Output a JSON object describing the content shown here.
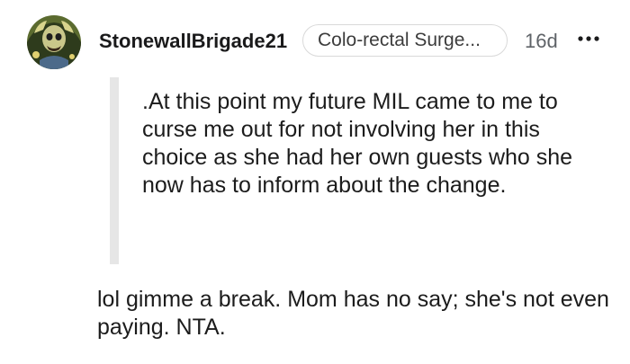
{
  "comment": {
    "author": "StonewallBrigade21",
    "flair": "Colo-rectal Surge...",
    "age": "16d",
    "more_icon": "more-horizontal-icon",
    "quote": ".At this point my future MIL came to me to curse me out for not involving her in this choice as she had her own guests who she now has to inform about the change.",
    "body": "lol gimme a break. Mom has no say; she's not even paying. NTA."
  },
  "colors": {
    "quote_bar": "#e6e6e6",
    "flair_border": "#d9d9d9",
    "muted_text": "#5f6368"
  }
}
